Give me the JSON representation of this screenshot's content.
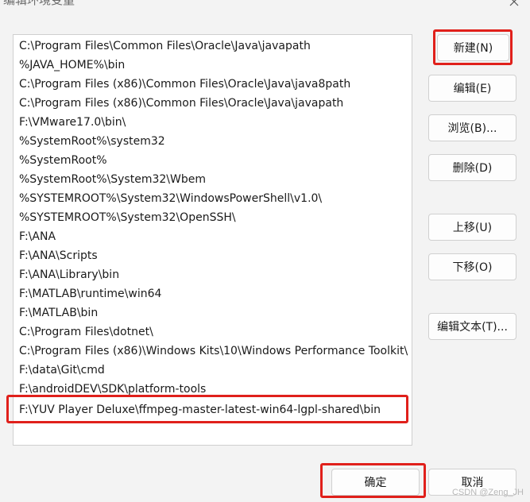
{
  "window": {
    "title": "编辑环境变量",
    "watermark": "CSDN @Zeng_JH"
  },
  "paths": [
    "C:\\Program Files\\Common Files\\Oracle\\Java\\javapath",
    "%JAVA_HOME%\\bin",
    "C:\\Program Files (x86)\\Common Files\\Oracle\\Java\\java8path",
    "C:\\Program Files (x86)\\Common Files\\Oracle\\Java\\javapath",
    "F:\\VMware17.0\\bin\\",
    "%SystemRoot%\\system32",
    "%SystemRoot%",
    "%SystemRoot%\\System32\\Wbem",
    "%SYSTEMROOT%\\System32\\WindowsPowerShell\\v1.0\\",
    "%SYSTEMROOT%\\System32\\OpenSSH\\",
    "F:\\ANA",
    "F:\\ANA\\Scripts",
    "F:\\ANA\\Library\\bin",
    "F:\\MATLAB\\runtime\\win64",
    "F:\\MATLAB\\bin",
    "C:\\Program Files\\dotnet\\",
    "C:\\Program Files (x86)\\Windows Kits\\10\\Windows Performance Toolkit\\",
    "F:\\data\\Git\\cmd",
    "F:\\androidDEV\\SDK\\platform-tools",
    "F:\\YUV Player Deluxe\\ffmpeg-master-latest-win64-lgpl-shared\\bin"
  ],
  "selected_index": 19,
  "buttons": {
    "new": "新建(N)",
    "edit": "编辑(E)",
    "browse": "浏览(B)...",
    "delete": "删除(D)",
    "move_up": "上移(U)",
    "move_down": "下移(O)",
    "edit_text": "编辑文本(T)...",
    "ok": "确定",
    "cancel": "取消"
  },
  "colors": {
    "highlight": "#e0201b",
    "background": "#f3f3f3"
  }
}
